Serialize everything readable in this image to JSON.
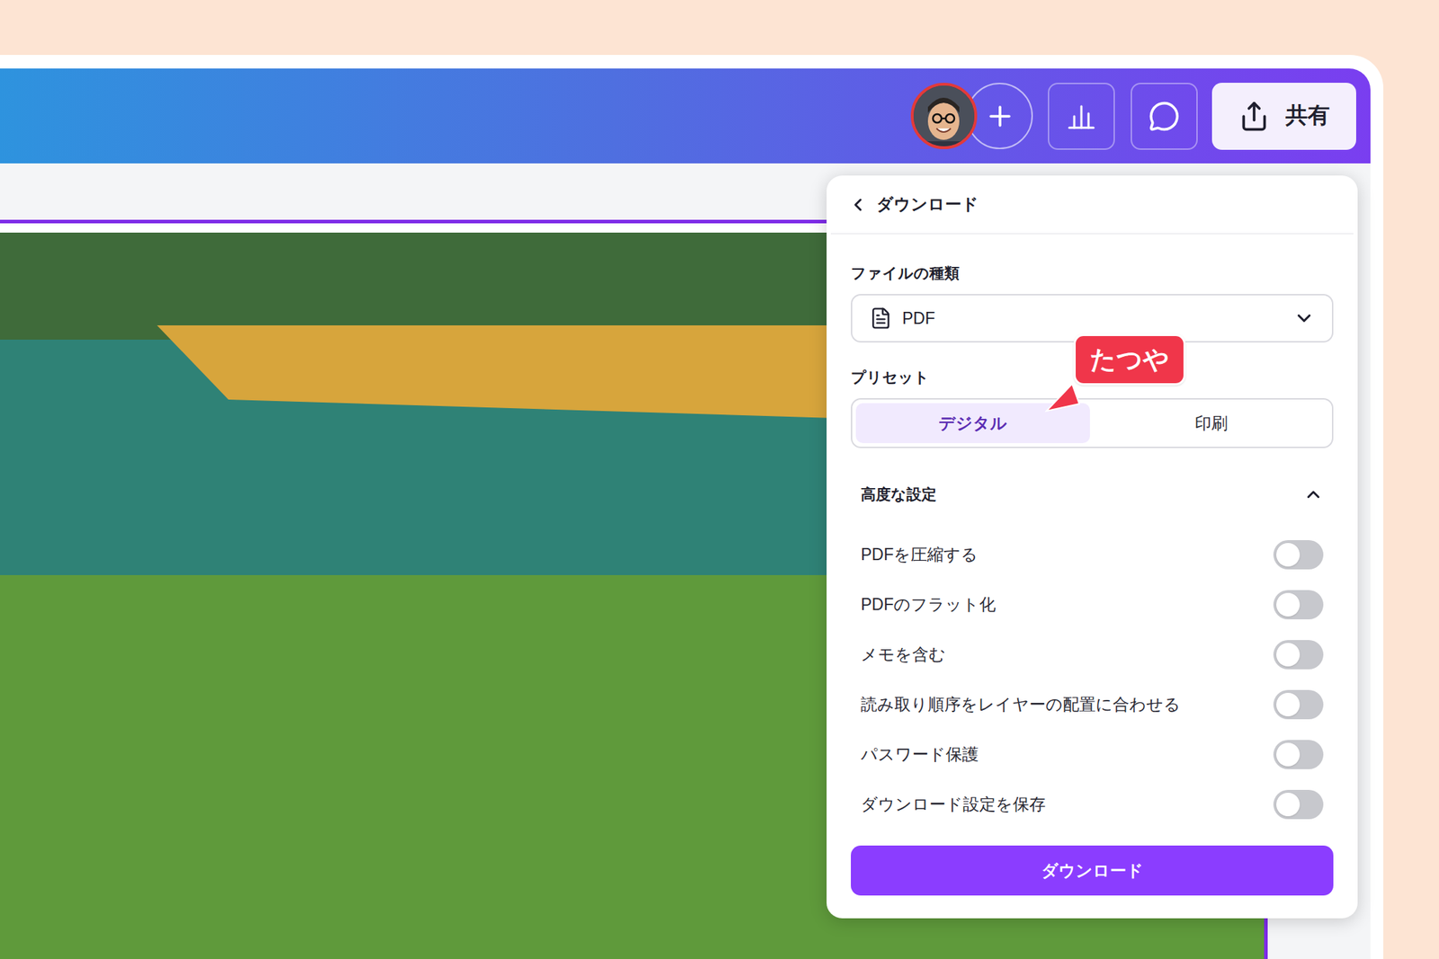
{
  "header": {
    "share_button": {
      "label": "共有"
    }
  },
  "download_panel": {
    "title": "ダウンロード",
    "file_type": {
      "label": "ファイルの種類",
      "value": "PDF"
    },
    "preset": {
      "label": "プリセット",
      "options": [
        {
          "label": "デジタル",
          "selected": true
        },
        {
          "label": "印刷",
          "selected": false
        }
      ]
    },
    "advanced": {
      "label": "高度な設定",
      "expanded": true,
      "options": [
        {
          "label": "PDFを圧縮する",
          "on": false
        },
        {
          "label": "PDFのフラット化",
          "on": false
        },
        {
          "label": "メモを含む",
          "on": false
        },
        {
          "label": "読み取り順序をレイヤーの配置に合わせる",
          "on": false
        },
        {
          "label": "パスワード保護",
          "on": false
        },
        {
          "label": "ダウンロード設定を保存",
          "on": false
        }
      ]
    },
    "download_button": {
      "label": "ダウンロード"
    }
  },
  "collaborator_cursor": {
    "name": "たつや"
  }
}
